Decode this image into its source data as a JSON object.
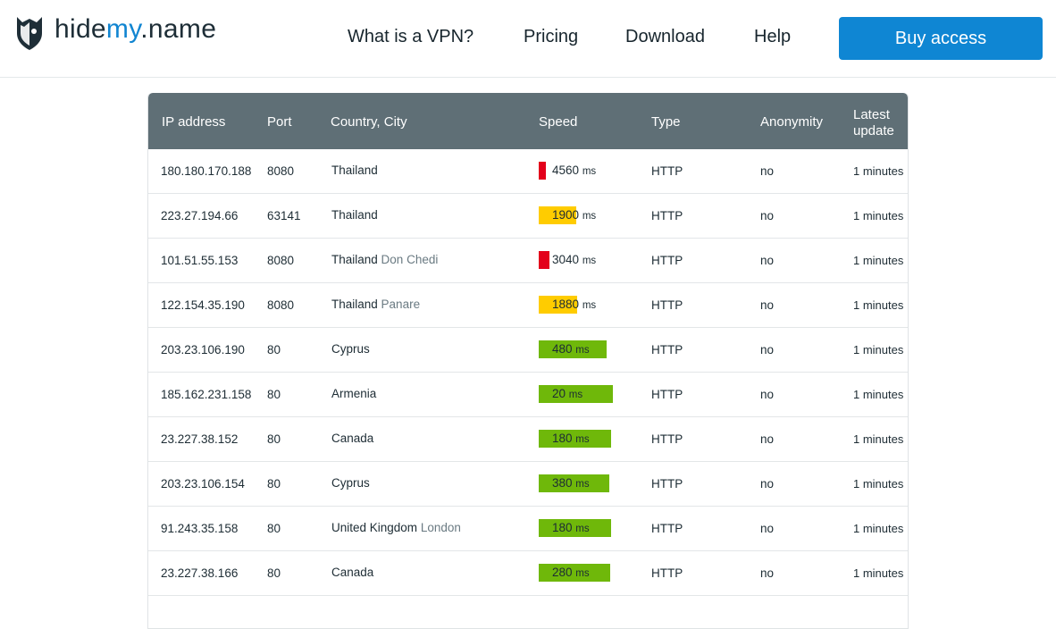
{
  "brand": {
    "logo_prefix": "hide",
    "logo_accent": "my",
    "logo_suffix": ".name"
  },
  "nav": [
    "What is a VPN?",
    "Pricing",
    "Download",
    "Help"
  ],
  "buy_button": "Buy access",
  "colors": {
    "accent": "#0f86d3",
    "header_bg": "#5f6f76",
    "speed_red": "#e3001b",
    "speed_yellow": "#ffcc00",
    "speed_green": "#6fb80a"
  },
  "table": {
    "headers": {
      "ip": "IP address",
      "port": "Port",
      "country": "Country, City",
      "speed": "Speed",
      "type": "Type",
      "anonymity": "Anonymity",
      "update_line1": "Latest",
      "update_line2": "update"
    },
    "ms_unit": "ms",
    "rows": [
      {
        "ip": "180.180.170.188",
        "port": "8080",
        "country": "Thailand",
        "city": "",
        "speed": "4560",
        "speed_level": "red",
        "speed_fill": 0.1,
        "type": "HTTP",
        "anonymity": "no",
        "updated": "1 minutes"
      },
      {
        "ip": "223.27.194.66",
        "port": "63141",
        "country": "Thailand",
        "city": "",
        "speed": "1900",
        "speed_level": "yellow",
        "speed_fill": 0.5,
        "type": "HTTP",
        "anonymity": "no",
        "updated": "1 minutes"
      },
      {
        "ip": "101.51.55.153",
        "port": "8080",
        "country": "Thailand",
        "city": "Don Chedi",
        "speed": "3040",
        "speed_level": "red",
        "speed_fill": 0.15,
        "type": "HTTP",
        "anonymity": "no",
        "updated": "1 minutes"
      },
      {
        "ip": "122.154.35.190",
        "port": "8080",
        "country": "Thailand",
        "city": "Panare",
        "speed": "1880",
        "speed_level": "yellow",
        "speed_fill": 0.52,
        "type": "HTTP",
        "anonymity": "no",
        "updated": "1 minutes"
      },
      {
        "ip": "203.23.106.190",
        "port": "80",
        "country": "Cyprus",
        "city": "",
        "speed": "480",
        "speed_level": "green",
        "speed_fill": 0.91,
        "type": "HTTP",
        "anonymity": "no",
        "updated": "1 minutes"
      },
      {
        "ip": "185.162.231.158",
        "port": "80",
        "country": "Armenia",
        "city": "",
        "speed": "20",
        "speed_level": "green",
        "speed_fill": 1.0,
        "type": "HTTP",
        "anonymity": "no",
        "updated": "1 minutes"
      },
      {
        "ip": "23.227.38.152",
        "port": "80",
        "country": "Canada",
        "city": "",
        "speed": "180",
        "speed_level": "green",
        "speed_fill": 0.97,
        "type": "HTTP",
        "anonymity": "no",
        "updated": "1 minutes"
      },
      {
        "ip": "203.23.106.154",
        "port": "80",
        "country": "Cyprus",
        "city": "",
        "speed": "380",
        "speed_level": "green",
        "speed_fill": 0.95,
        "type": "HTTP",
        "anonymity": "no",
        "updated": "1 minutes"
      },
      {
        "ip": "91.243.35.158",
        "port": "80",
        "country": "United Kingdom",
        "city": "London",
        "speed": "180",
        "speed_level": "green",
        "speed_fill": 0.97,
        "type": "HTTP",
        "anonymity": "no",
        "updated": "1 minutes"
      },
      {
        "ip": "23.227.38.166",
        "port": "80",
        "country": "Canada",
        "city": "",
        "speed": "280",
        "speed_level": "green",
        "speed_fill": 0.96,
        "type": "HTTP",
        "anonymity": "no",
        "updated": "1 minutes"
      }
    ]
  }
}
